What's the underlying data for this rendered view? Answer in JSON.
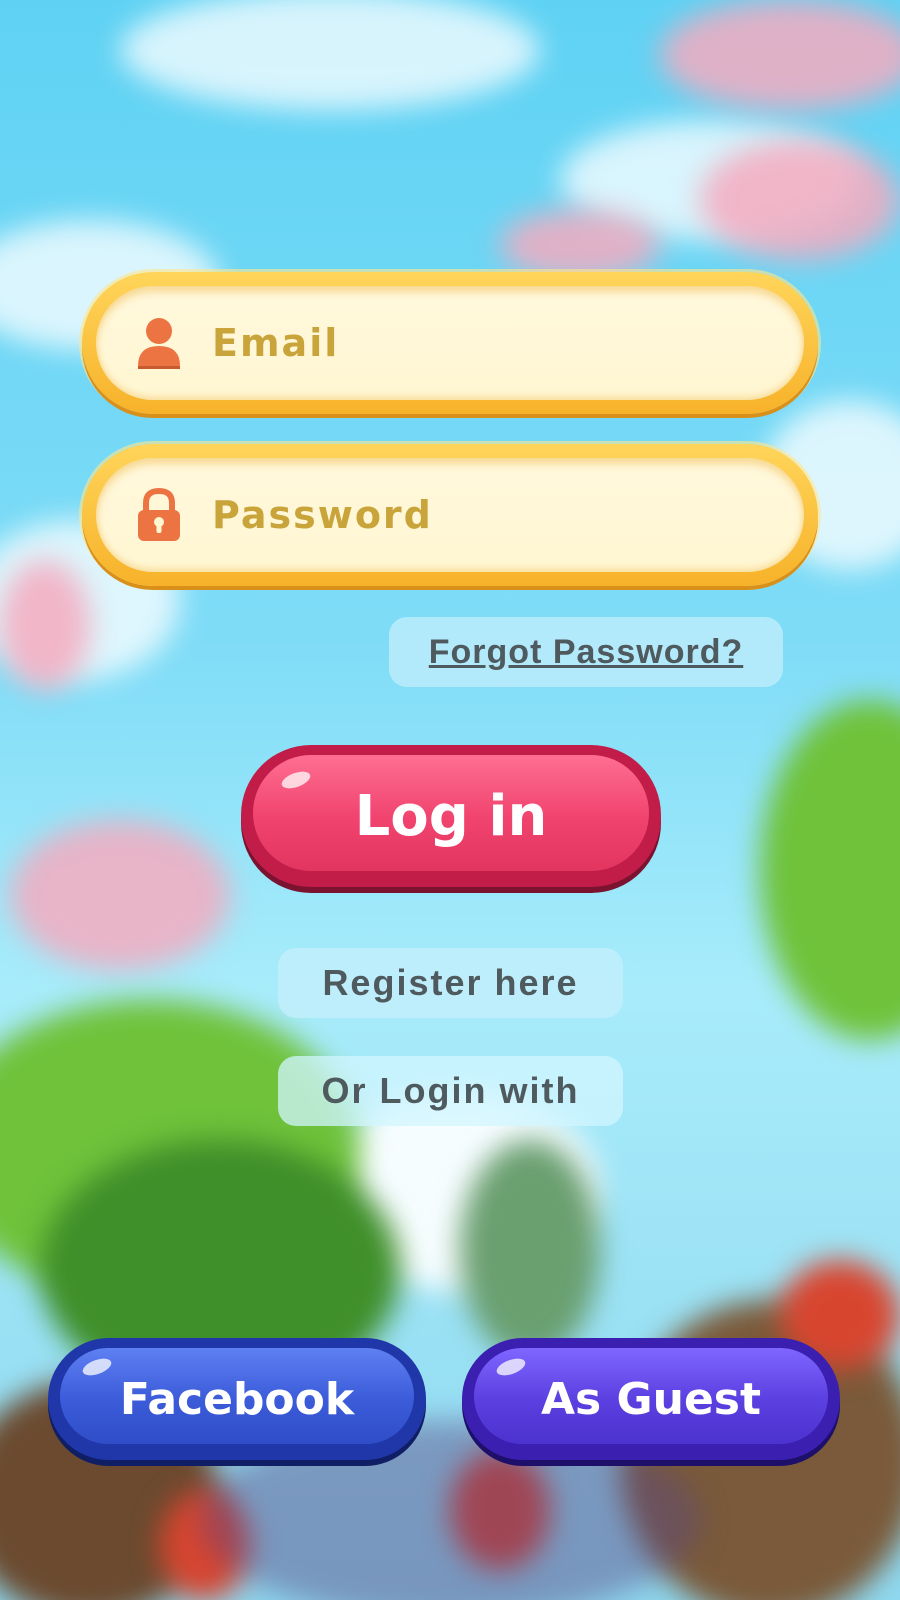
{
  "login_form": {
    "email_placeholder": "Email",
    "email_icon": "user-icon",
    "password_placeholder": "Password",
    "password_icon": "lock-icon",
    "forgot_password_label": "Forgot Password?",
    "login_button_label": "Log in",
    "register_label": "Register here",
    "or_login_with_label": "Or Login with",
    "facebook_button_label": "Facebook",
    "guest_button_label": "As Guest"
  },
  "colors": {
    "field_border": "#f7b22a",
    "field_fill": "#fff6d2",
    "placeholder_text": "#c9a43a",
    "icon_orange": "#ec7442",
    "login_button": "#f0436e",
    "facebook_button": "#3b5bd9",
    "guest_button": "#5b3fe0",
    "label_text": "#4f5a5e"
  }
}
